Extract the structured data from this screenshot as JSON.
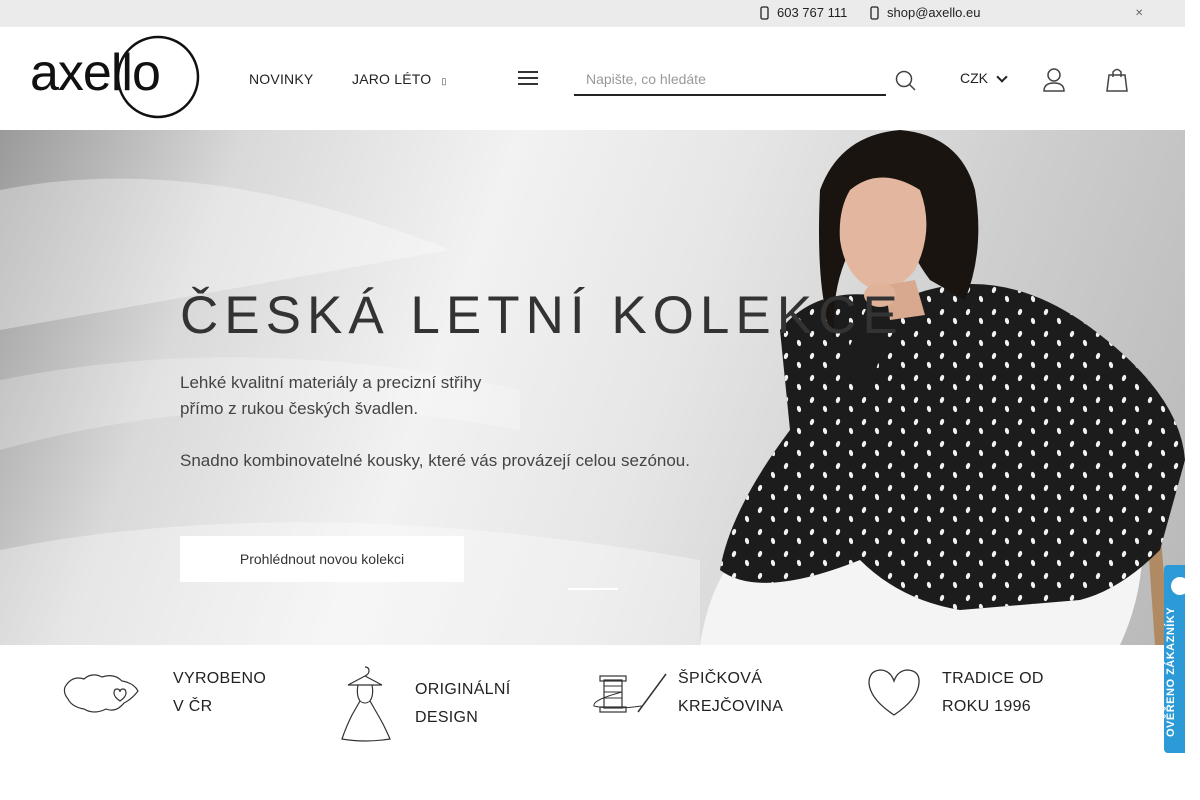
{
  "topbar": {
    "phone": "603 767 111",
    "email": "shop@axello.eu",
    "phone_icon": "phone-icon",
    "email_icon": "mail-icon",
    "close_icon": "close-icon"
  },
  "header": {
    "logo_text": "axello",
    "nav": [
      {
        "label": "NOVINKY"
      },
      {
        "label": "JARO LÉTO"
      }
    ],
    "search_placeholder": "Napište, co hledáte",
    "currency": "CZK"
  },
  "hero": {
    "title": "ČESKÁ LETNÍ KOLEKCE",
    "text_line1": "Lehké kvalitní materiály a precizní střihy",
    "text_line2": "přímo z rukou českých švadlen.",
    "text_line3": "Snadno kombinovatelné kousky, které vás provázejí celou sezónou.",
    "button": "Prohlédnout novou kolekci"
  },
  "features": [
    {
      "line1": "VYROBENO",
      "line2": "V ČR",
      "icon": "czech-map-heart-icon"
    },
    {
      "line1": "ORIGINÁLNÍ",
      "line2": "DESIGN",
      "icon": "dress-on-hanger-icon"
    },
    {
      "line1": "ŠPIČKOVÁ",
      "line2": "KREJČOVINA",
      "icon": "thread-spool-needle-icon"
    },
    {
      "line1": "TRADICE OD",
      "line2": "ROKU 1996",
      "icon": "heart-icon"
    }
  ],
  "badge": {
    "text": "OVĚŘENO ZÁKAZNÍKY"
  },
  "colors": {
    "badge_blue": "#2b9ad6",
    "topbar_bg": "#ebebeb",
    "text_dark": "#222222"
  }
}
